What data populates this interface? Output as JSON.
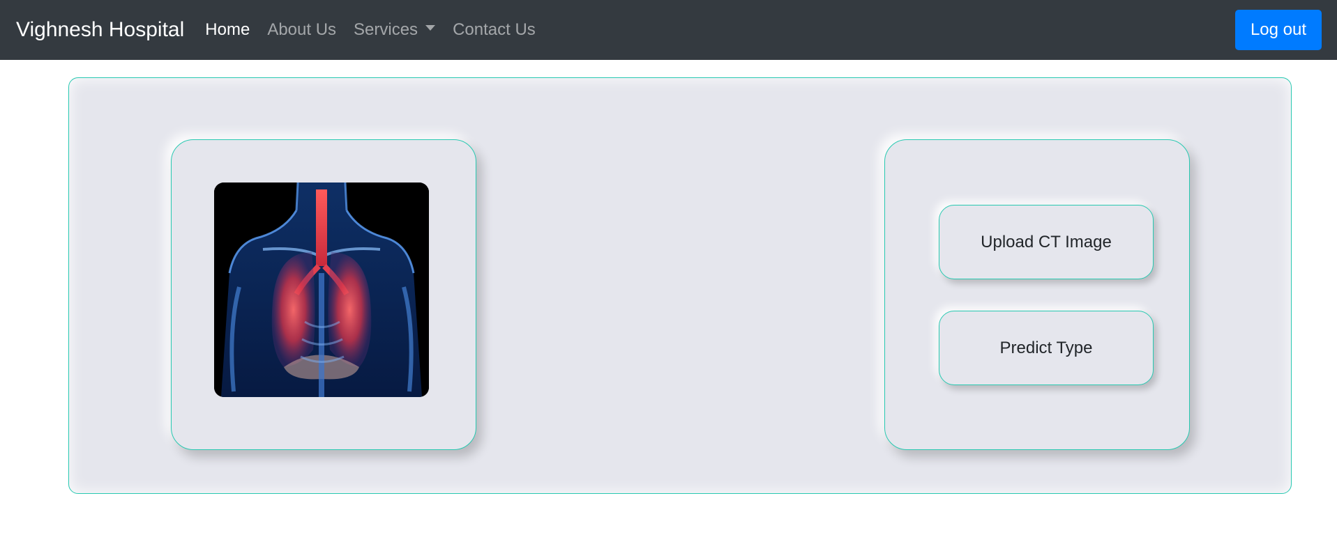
{
  "navbar": {
    "brand": "Vighnesh Hospital",
    "items": [
      {
        "label": "Home",
        "active": true
      },
      {
        "label": "About Us",
        "active": false
      },
      {
        "label": "Services",
        "active": false,
        "dropdown": true
      },
      {
        "label": "Contact Us",
        "active": false
      }
    ],
    "logout_label": "Log out"
  },
  "image_card": {
    "image": "lungs-xray-illustration"
  },
  "actions": {
    "upload_label": "Upload CT Image",
    "predict_label": "Predict Type"
  },
  "colors": {
    "navbar_bg": "#343a40",
    "accent_border": "#27c9b1",
    "logout_bg": "#007bff",
    "panel_bg": "#e5e6ed"
  }
}
